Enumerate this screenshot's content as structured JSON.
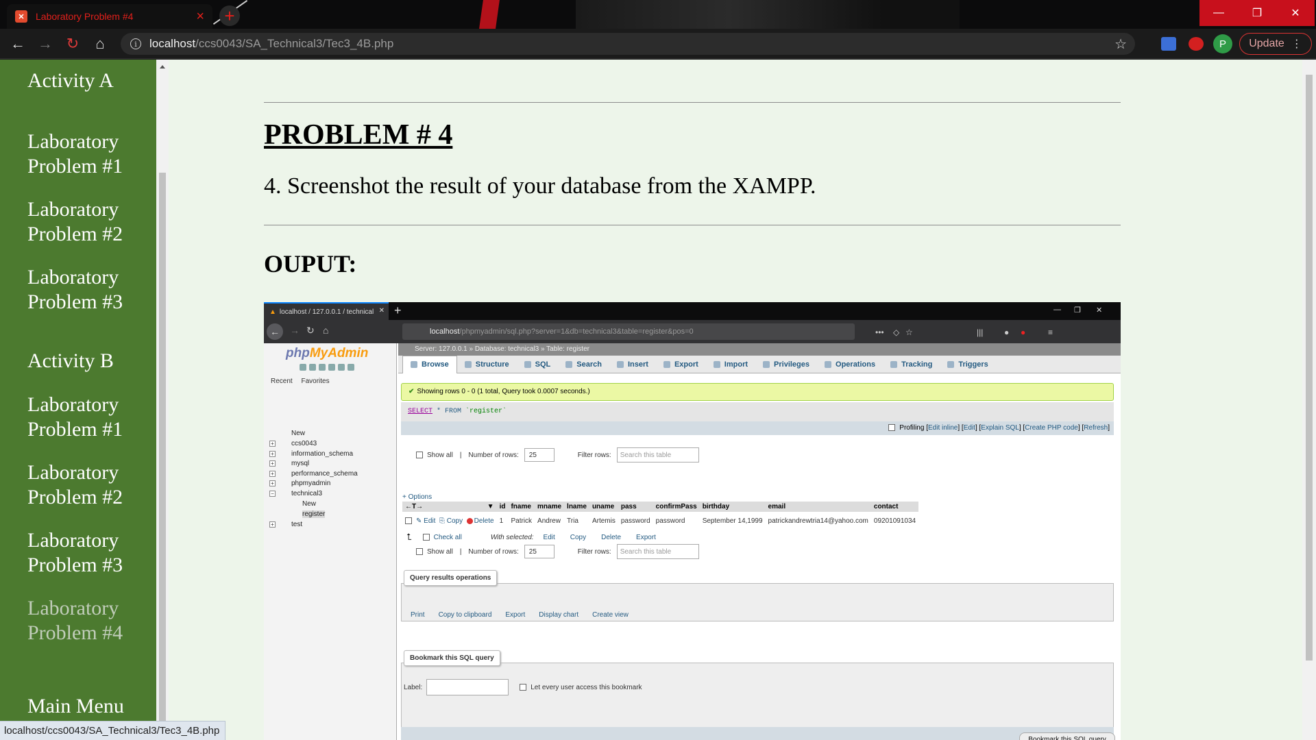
{
  "browser": {
    "tab_title": "Laboratory Problem #4",
    "tab_favicon": "xampp-icon",
    "url_host": "localhost",
    "url_path": "/ccs0043/SA_Technical3/Tec3_4B.php",
    "profile_initial": "P",
    "update_label": "Update",
    "status_url": "localhost/ccs0043/SA_Technical3/Tec3_4B.php",
    "accent_color": "#c8101c"
  },
  "sidebar": {
    "items": [
      {
        "label": "Activity A"
      },
      {
        "label": "Laboratory Problem #1"
      },
      {
        "label": "Laboratory Problem #2"
      },
      {
        "label": "Laboratory Problem #3"
      },
      {
        "label": "Activity B"
      },
      {
        "label": "Laboratory Problem #1"
      },
      {
        "label": "Laboratory Problem #2"
      },
      {
        "label": "Laboratory Problem #3"
      },
      {
        "label": "Laboratory Problem #4"
      },
      {
        "label": "Main Menu"
      }
    ],
    "bg_color": "#4c7a2f"
  },
  "main": {
    "heading": "PROBLEM # 4",
    "instruction": "4. Screenshot the result of your database from the XAMPP.",
    "output_label": "OUPUT:",
    "bg_color": "#edf5ea"
  },
  "screenshot": {
    "ff_tab_title": "localhost / 127.0.0.1 / technical",
    "ff_url_host": "localhost",
    "ff_url_path": "/phpmyadmin/sql.php?server=1&db=technical3&table=register&pos=0",
    "logo_php": "php",
    "logo_my": "MyAdmin",
    "left_tabs": [
      "Recent",
      "Favorites"
    ],
    "tree": [
      {
        "label": "New"
      },
      {
        "label": "ccs0043"
      },
      {
        "label": "information_schema"
      },
      {
        "label": "mysql"
      },
      {
        "label": "performance_schema"
      },
      {
        "label": "phpmyadmin"
      },
      {
        "label": "technical3"
      },
      {
        "label": "New"
      },
      {
        "label": "register"
      },
      {
        "label": "test"
      }
    ],
    "breadcrumb": "Server: 127.0.0.1 » Database: technical3 » Table: register",
    "menu_tabs": [
      "Browse",
      "Structure",
      "SQL",
      "Search",
      "Insert",
      "Export",
      "Import",
      "Privileges",
      "Operations",
      "Tracking",
      "Triggers"
    ],
    "success_msg": "Showing rows 0 - 0 (1 total, Query took 0.0007 seconds.)",
    "sql_kw": "SELECT",
    "sql_rest": " * FROM ",
    "sql_table": "`register`",
    "profiling": "Profiling",
    "prof_links": [
      "Edit inline",
      "Edit",
      "Explain SQL",
      "Create PHP code",
      "Refresh"
    ],
    "show_all": "Show all",
    "num_rows_label": "Number of rows:",
    "num_rows_value": "25",
    "filter_label": "Filter rows:",
    "filter_placeholder": "Search this table",
    "options_link": "+ Options",
    "columns": [
      "id",
      "fname",
      "mname",
      "lname",
      "uname",
      "pass",
      "confirmPass",
      "birthday",
      "email",
      "contact"
    ],
    "row": {
      "edit": "Edit",
      "copy": "Copy",
      "delete": "Delete",
      "id": "1",
      "fname": "Patrick",
      "mname": "Andrew",
      "lname": "Tria",
      "uname": "Artemis",
      "pass": "password",
      "confirmPass": "password",
      "birthday": "September 14,1999",
      "email": "patrickandrewtria14@yahoo.com",
      "contact": "09201091034"
    },
    "check_all": "Check all",
    "with_selected": "With selected:",
    "bulk_actions": [
      "Edit",
      "Copy",
      "Delete",
      "Export"
    ],
    "qro_legend": "Query results operations",
    "qro_links": [
      "Print",
      "Copy to clipboard",
      "Export",
      "Display chart",
      "Create view"
    ],
    "bookmark_legend": "Bookmark this SQL query",
    "label_field": "Label:",
    "let_every_user": "Let every user access this bookmark",
    "bookmark_button": "Bookmark this SQL query"
  }
}
